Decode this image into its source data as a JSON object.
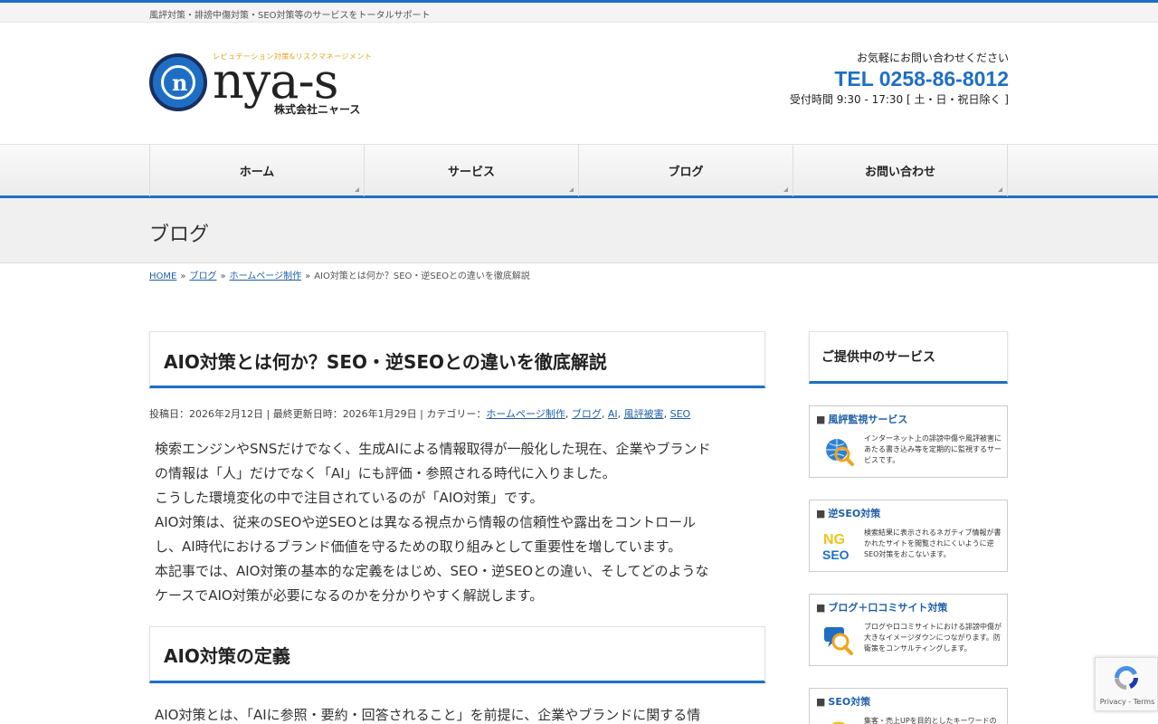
{
  "tagline": "風評対策・誹謗中傷対策・SEO対策等のサービスをトータルサポート",
  "logo": {
    "tag": "レピュテーション対策&リスクマネージメント",
    "name": "nya-s",
    "company": "株式会社ニャース"
  },
  "contact": {
    "lead": "お気軽にお問い合わせください",
    "tel": "TEL 0258-86-8012",
    "hours": "受付時間 9:30 - 17:30 [ 土・日・祝日除く ]"
  },
  "nav": [
    "ホーム",
    "サービス",
    "ブログ",
    "お問い合わせ"
  ],
  "page_title": "ブログ",
  "breadcrumb": {
    "home": "HOME",
    "blog": "ブログ",
    "category": "ホームページ制作",
    "current": "AIO対策とは何か？SEO・逆SEOとの違いを徹底解説",
    "sep": "»"
  },
  "post": {
    "title": "AIO対策とは何か？SEO・逆SEOとの違いを徹底解説",
    "meta_prefix": "投稿日：2026年2月12日 | 最終更新日時：2026年1月29日 | カテゴリー：",
    "categories": [
      "ホームページ制作",
      "ブログ",
      "AI",
      "風評被害",
      "SEO"
    ],
    "paragraphs": [
      "検索エンジンやSNSだけでなく、生成AIによる情報取得が一般化した現在、企業やブランド",
      "の情報は「人」だけでなく「AI」にも評価・参照される時代に入りました。",
      "こうした環境変化の中で注目されているのが「AIO対策」です。",
      "AIO対策は、従来のSEOや逆SEOとは異なる視点から情報の信頼性や露出をコントロール",
      "し、AI時代におけるブランド価値を守るための取り組みとして重要性を増しています。",
      "本記事では、AIO対策の基本的な定義をはじめ、SEO・逆SEOとの違い、そしてどのような",
      "ケースでAIO対策が必要になるのかを分かりやすく解説します。"
    ],
    "section_title": "AIO対策の定義",
    "section_text": "AIO対策とは、「AIに参照・要約・回答されること」を前提に、企業やブランドに関する情"
  },
  "sidebar": {
    "heading": "ご提供中のサービス",
    "services": [
      {
        "title": "風評監視サービス",
        "icon": "globe-magnifier-icon",
        "desc": "インターネット上の誹謗中傷や風評被害にあたる書き込み等を定期的に監視するサービスです。"
      },
      {
        "title": "逆SEO対策",
        "icon": "ng-seo-icon",
        "icon_text_top": "NG",
        "icon_text_bottom": "SEO",
        "desc": "検索結果に表示されるネガティブ情報が書かれたサイトを閲覧されにくいように逆SEO対策をおこないます。"
      },
      {
        "title": "ブログ＋口コミサイト対策",
        "icon": "review-magnifier-icon",
        "desc": "ブログや口コミサイトにおける誹謗中傷が大きなイメージダウンにつながります。防衛策をコンサルティングします。"
      },
      {
        "title": "SEO対策",
        "icon": "seo-icon",
        "desc": "集客・売上UPを目的としたキーワードの"
      }
    ]
  },
  "recaptcha": {
    "links": "Privacy - Terms"
  },
  "colors": {
    "accent": "#1e6fc4",
    "link": "#1f5fa8",
    "logo_tag": "#e8a11c"
  }
}
